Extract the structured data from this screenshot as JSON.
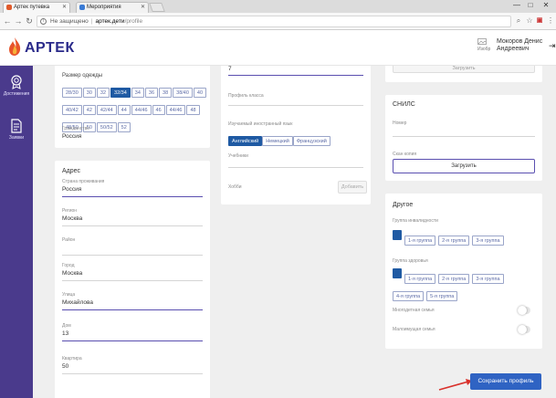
{
  "browser": {
    "tabs": [
      {
        "title": "Артек путевка",
        "fav_color": "#e05a2b"
      },
      {
        "title": "Мероприятия",
        "fav_color": "#3a7bd5"
      }
    ],
    "address": {
      "security": "Не защищено",
      "host": "артек.дети",
      "path": "/profile"
    },
    "window_controls": [
      "—",
      "□",
      "✕"
    ]
  },
  "header": {
    "logo_text": "АРТЕК",
    "user_image_alt": "Изобр",
    "user_name": "Мокоров Денис Андреевич"
  },
  "sidebar": {
    "items": [
      {
        "label": "Достижения",
        "icon": "medal-icon"
      },
      {
        "label": "Заявки",
        "icon": "document-icon"
      }
    ]
  },
  "clothing": {
    "label": "Размер одежды",
    "sizes": [
      "28/30",
      "30",
      "32",
      "32/34",
      "34",
      "36",
      "38",
      "38/40",
      "40",
      "40/42",
      "42",
      "42/44",
      "44",
      "44/46",
      "46",
      "44/46",
      "48",
      "48/50",
      "50",
      "50/52",
      "52"
    ],
    "selected_index": 3,
    "citizenship_label": "Гражданство",
    "citizenship_value": "Россия"
  },
  "address": {
    "title": "Адрес",
    "fields": [
      {
        "label": "Страна проживания",
        "value": "Россия",
        "focus": true
      },
      {
        "label": "Регион",
        "value": "Москва",
        "focus": false
      },
      {
        "label": "Район",
        "value": "",
        "focus": false
      },
      {
        "label": "Город",
        "value": "Москва",
        "focus": false
      },
      {
        "label": "Улица",
        "value": "Михайлова",
        "focus": true
      },
      {
        "label": "Дом",
        "value": "13",
        "focus": true
      },
      {
        "label": "Квартира",
        "value": "50",
        "focus": false
      }
    ]
  },
  "middle": {
    "top_value": "7",
    "class_profile_label": "Профиль класса",
    "languages_label": "Изучаемый иностранный язык",
    "languages": [
      "Английский",
      "Немецкий",
      "Французский"
    ],
    "languages_selected": 0,
    "textbooks_label": "Учебники",
    "hobby_label": "Хобби",
    "add_button": "Добавить"
  },
  "snils": {
    "title": "СНИЛС",
    "number_label": "Номер",
    "scan_label": "Скан копия",
    "upload_button": "Загрузить",
    "top_upload_button": "Загрузить"
  },
  "other": {
    "title": "Другое",
    "disability_label": "Группа инвалидности",
    "disability_options": [
      "",
      "1-я группа",
      "2-я группа",
      "3-я группа"
    ],
    "disability_selected": 0,
    "health_label": "Группа здоровья",
    "health_options": [
      "",
      "1-я группа",
      "2-я группа",
      "3-я группа",
      "4-я группа",
      "5-я группа"
    ],
    "health_selected": 0,
    "large_family_label": "Многодетная семья",
    "low_income_label": "Малоимущая семья"
  },
  "actions": {
    "save": "Сохранить профиль"
  },
  "colors": {
    "sidebar": "#4a3a8c",
    "accent": "#5a4fb0",
    "chip_selected": "#1f5aa3",
    "save_button": "#2f63c3",
    "arrow": "#d9312b"
  }
}
